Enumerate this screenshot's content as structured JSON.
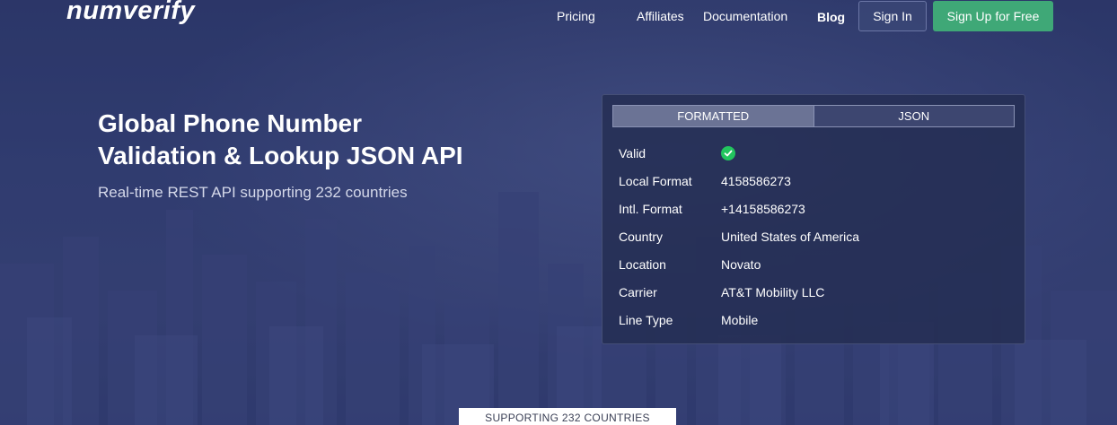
{
  "brand": {
    "logo_text": "numverify"
  },
  "nav": {
    "pricing": "Pricing",
    "affiliates": "Affiliates",
    "documentation": "Documentation",
    "blog": "Blog",
    "sign_in": "Sign In",
    "sign_up": "Sign Up for Free"
  },
  "hero": {
    "title_line1": "Global Phone Number",
    "title_line2": "Validation & Lookup JSON API",
    "subtitle": "Real-time REST API supporting 232 countries"
  },
  "panel": {
    "tabs": [
      {
        "label": "FORMATTED",
        "active": true
      },
      {
        "label": "JSON",
        "active": false
      }
    ],
    "rows": [
      {
        "key": "Valid",
        "value": "",
        "icon": "check-circle-icon"
      },
      {
        "key": "Local Format",
        "value": "4158586273"
      },
      {
        "key": "Intl. Format",
        "value": "+14158586273"
      },
      {
        "key": "Country",
        "value": "United States of America"
      },
      {
        "key": "Location",
        "value": "Novato"
      },
      {
        "key": "Carrier",
        "value": "AT&T Mobility LLC"
      },
      {
        "key": "Line Type",
        "value": "Mobile"
      }
    ]
  },
  "footer_badge": "SUPPORTING 232 COUNTRIES",
  "colors": {
    "background": "#2f3a6c",
    "signup_button": "#3fa877",
    "valid_check": "#22c55e"
  }
}
